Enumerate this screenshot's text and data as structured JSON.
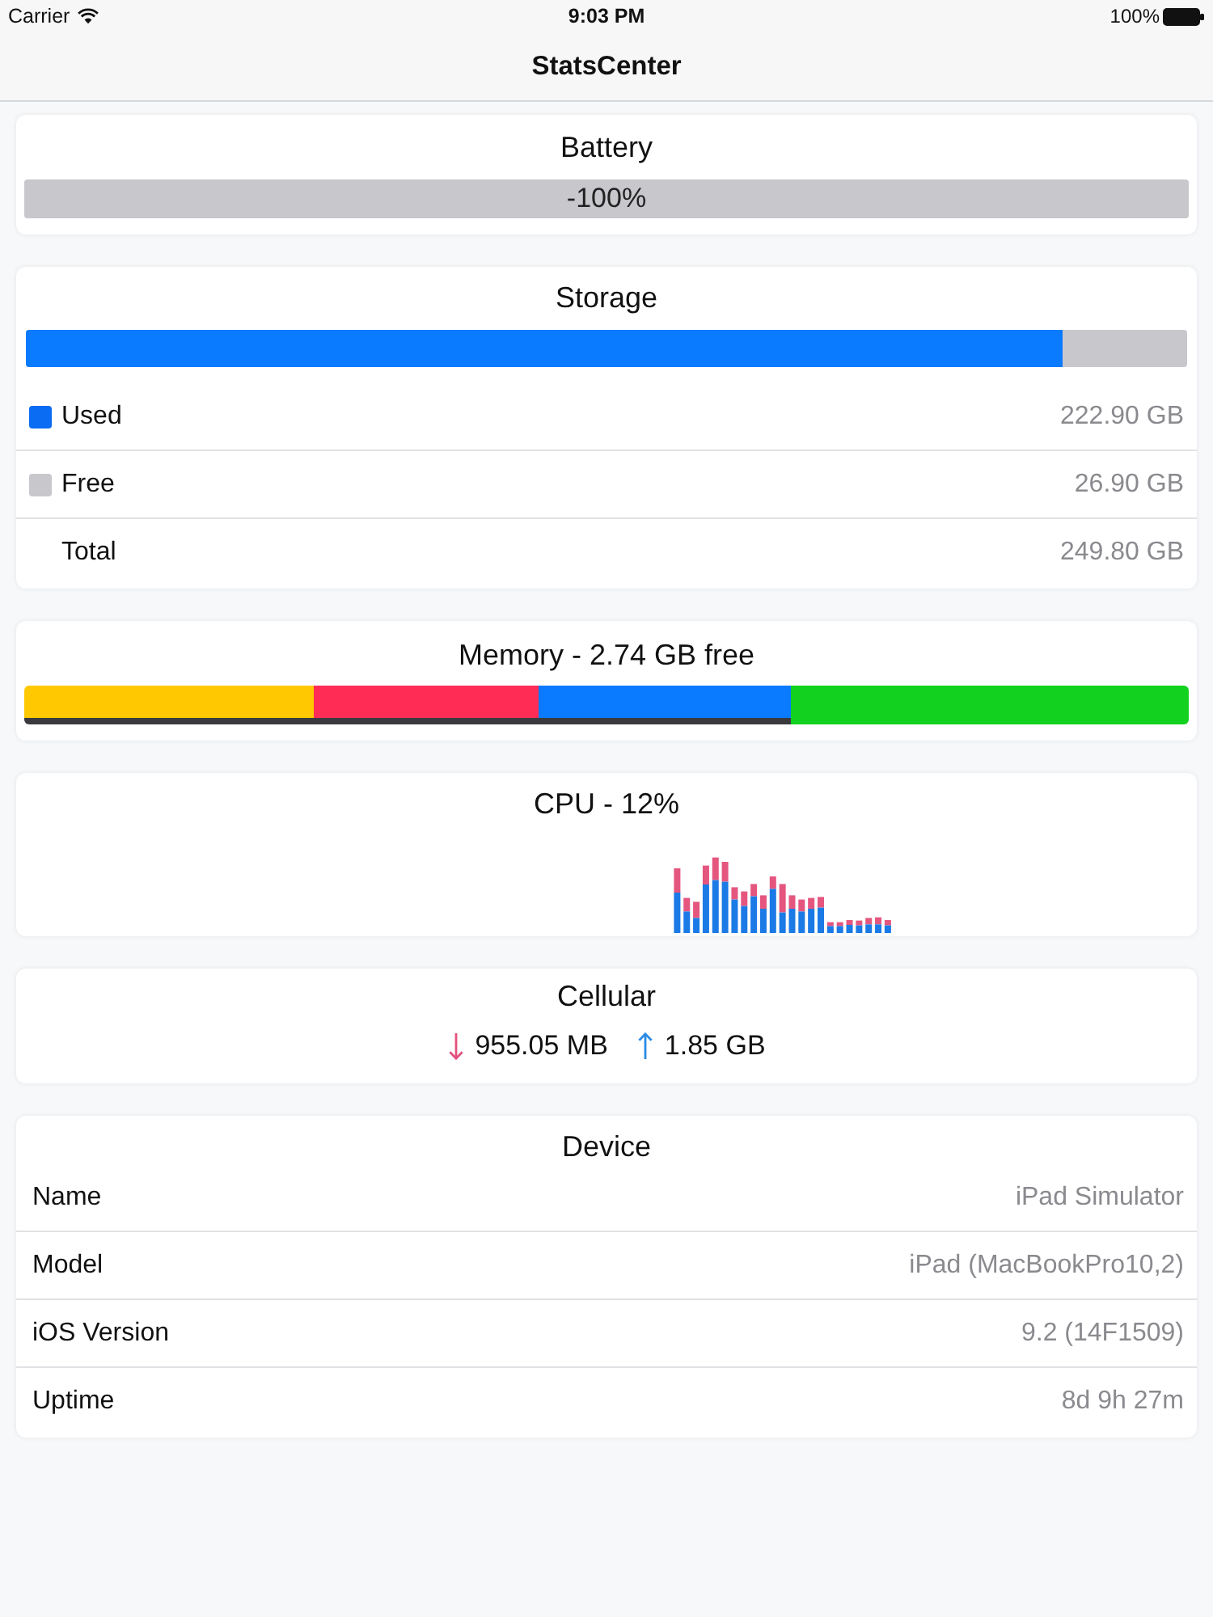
{
  "status_bar": {
    "carrier": "Carrier",
    "time": "9:03 PM",
    "battery": "100%"
  },
  "nav_bar": {
    "title": "StatsCenter"
  },
  "battery": {
    "title": "Battery",
    "reading": "-100%"
  },
  "storage": {
    "title": "Storage",
    "level": 0.893,
    "rows": [
      {
        "label": "Used",
        "value": "222.90 GB",
        "color": "#0a6cf2"
      },
      {
        "label": "Free",
        "value": "26.90 GB",
        "color": "#c8c8cc"
      },
      {
        "label": "Total",
        "value": "249.80 GB"
      }
    ]
  },
  "memory": {
    "title": "Memory - 2.74 GB free"
  },
  "cpu": {
    "title": "CPU - 12%"
  },
  "cellular": {
    "title": "Cellular",
    "items": [
      {
        "kind": "download",
        "value": "955.05 MB"
      },
      {
        "kind": "upload",
        "value": "1.85 GB"
      }
    ]
  },
  "device": {
    "title": "Device",
    "rows": [
      {
        "label": "Name",
        "value": "iPad Simulator"
      },
      {
        "label": "Model",
        "value": "iPad (MacBookPro10,2)"
      },
      {
        "label": "iOS Version",
        "value": "9.2 (14F1509)"
      },
      {
        "label": "Uptime",
        "value": "8d 9h 27m"
      }
    ]
  }
}
